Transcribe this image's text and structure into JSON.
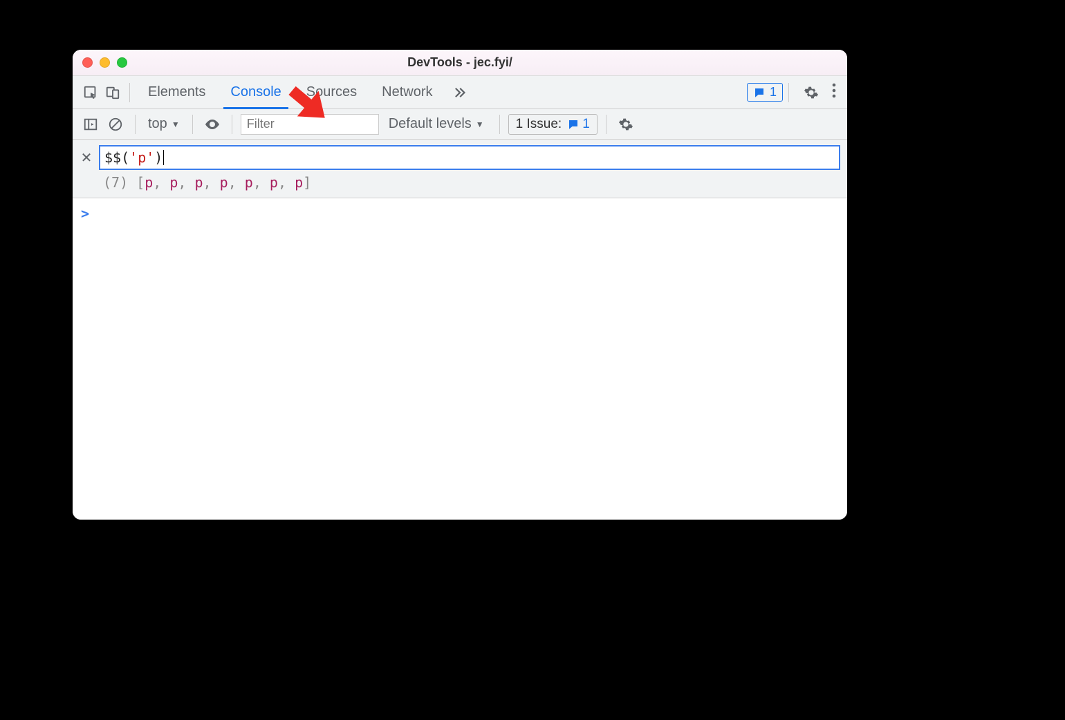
{
  "titlebar": {
    "title": "DevTools - jec.fyi/"
  },
  "tabs": {
    "items": [
      "Elements",
      "Console",
      "Sources",
      "Network"
    ],
    "active_index": 1,
    "more_tooltip": "More tabs"
  },
  "messages_badge": {
    "count": "1"
  },
  "console_toolbar": {
    "context": "top",
    "filter_placeholder": "Filter",
    "levels_label": "Default levels",
    "issues": {
      "label": "1 Issue:",
      "count": "1"
    }
  },
  "eager_eval": {
    "input_tokens": {
      "dollar": "$$",
      "open": "(",
      "quote1": "'",
      "ident": "p",
      "quote2": "'",
      "close": ")"
    },
    "result": {
      "count_label": "(7)",
      "elements": [
        "p",
        "p",
        "p",
        "p",
        "p",
        "p",
        "p"
      ]
    }
  },
  "prompt": {
    "chevron": ">"
  }
}
